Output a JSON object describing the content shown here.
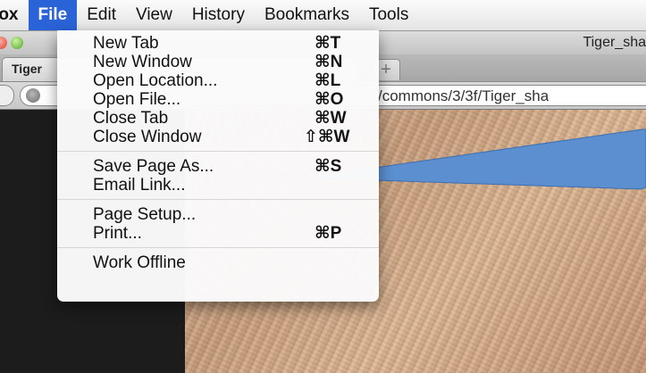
{
  "menubar": {
    "app": "fox",
    "items": [
      "File",
      "Edit",
      "View",
      "History",
      "Bookmarks",
      "Tools"
    ],
    "active_index": 0
  },
  "window": {
    "title": "Tiger_sha",
    "tab_label": "Tiger",
    "newtab_glyph": "+",
    "url": "/commons/3/3f/Tiger_sha"
  },
  "file_menu": {
    "groups": [
      [
        {
          "label": "New Tab",
          "shortcut": "⌘T"
        },
        {
          "label": "New Window",
          "shortcut": "⌘N"
        },
        {
          "label": "Open Location...",
          "shortcut": "⌘L"
        },
        {
          "label": "Open File...",
          "shortcut": "⌘O"
        },
        {
          "label": "Close Tab",
          "shortcut": "⌘W"
        },
        {
          "label": "Close Window",
          "shortcut": "⇧⌘W"
        }
      ],
      [
        {
          "label": "Save Page As...",
          "shortcut": "⌘S"
        },
        {
          "label": "Email Link...",
          "shortcut": ""
        }
      ],
      [
        {
          "label": "Page Setup...",
          "shortcut": ""
        },
        {
          "label": "Print...",
          "shortcut": "⌘P"
        }
      ],
      [
        {
          "label": "Work Offline",
          "shortcut": ""
        }
      ]
    ]
  },
  "colors": {
    "menu_highlight": "#2a63d8",
    "callout": "#5b8fd0"
  }
}
